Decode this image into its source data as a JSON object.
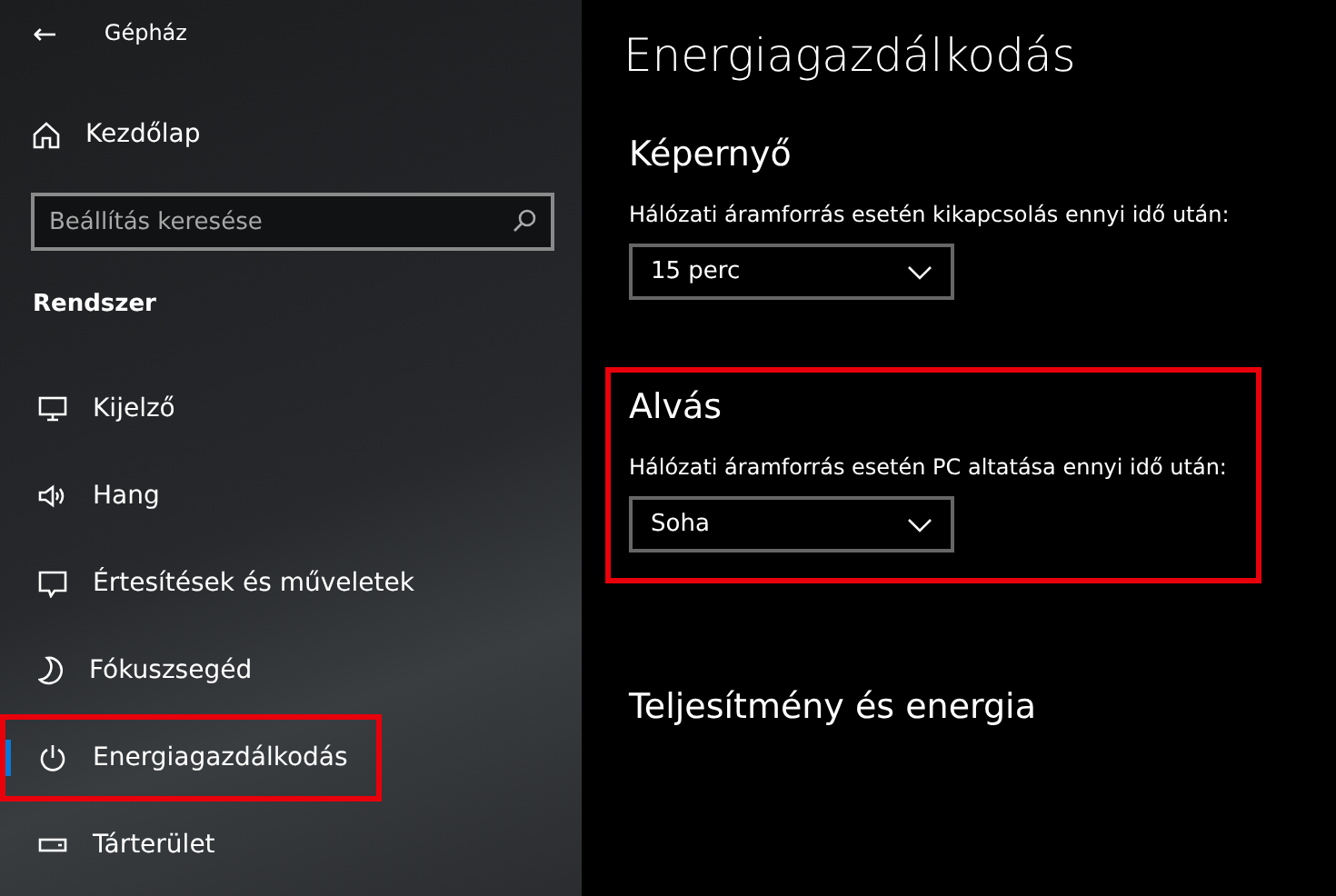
{
  "window": {
    "title": "Gépház",
    "back": "←"
  },
  "sidebar": {
    "home": "Kezdőlap",
    "search": {
      "placeholder": "Beállítás keresése"
    },
    "group": "Rendszer",
    "items": [
      {
        "label": "Kijelző",
        "selected": false,
        "highlighted": false
      },
      {
        "label": "Hang",
        "selected": false,
        "highlighted": false
      },
      {
        "label": "Értesítések és műveletek",
        "selected": false,
        "highlighted": false
      },
      {
        "label": "Fókuszsegéd",
        "selected": false,
        "highlighted": false
      },
      {
        "label": "Energiagazdálkodás",
        "selected": true,
        "highlighted": true
      },
      {
        "label": "Tárterület",
        "selected": false,
        "highlighted": false
      }
    ]
  },
  "main": {
    "title": "Energiagazdálkodás",
    "sections": [
      {
        "heading": "Képernyő",
        "highlighted": false,
        "setting": {
          "label": "Hálózati áramforrás esetén kikapcsolás ennyi idő után:",
          "value": "15 perc"
        }
      },
      {
        "heading": "Alvás",
        "highlighted": true,
        "setting": {
          "label": "Hálózati áramforrás esetén PC altatása ennyi idő után:",
          "value": "Soha"
        }
      },
      {
        "heading": "Teljesítmény és energia",
        "highlighted": false
      }
    ]
  }
}
